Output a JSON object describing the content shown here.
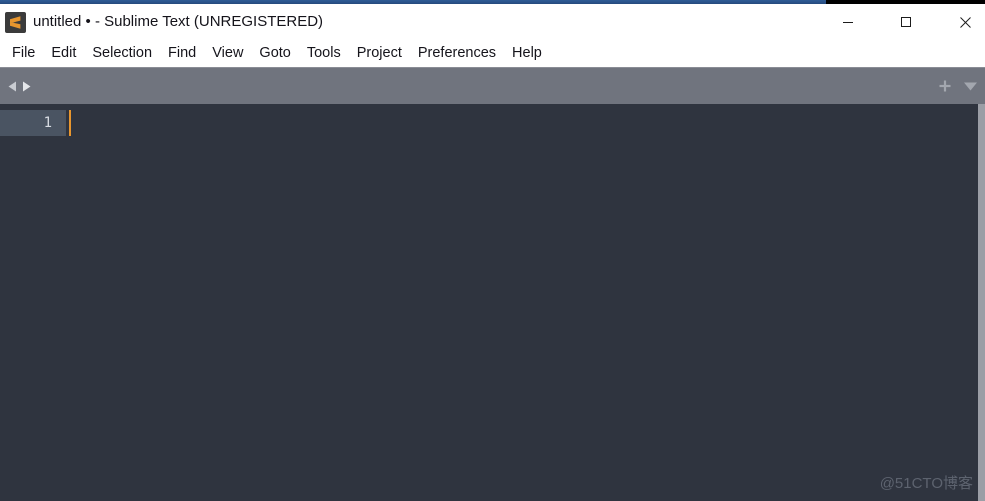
{
  "window": {
    "title": "untitled • - Sublime Text (UNREGISTERED)",
    "logo_icon": "sublime-text-logo",
    "accent_color": "#2a5289",
    "controls": {
      "minimize_label": "Minimize",
      "minimize_icon": "minimize-icon",
      "maximize_label": "Maximize",
      "maximize_icon": "maximize-icon",
      "close_label": "Close",
      "close_icon": "close-icon"
    }
  },
  "menubar": {
    "items": [
      {
        "label": "File"
      },
      {
        "label": "Edit"
      },
      {
        "label": "Selection"
      },
      {
        "label": "Find"
      },
      {
        "label": "View"
      },
      {
        "label": "Goto"
      },
      {
        "label": "Tools"
      },
      {
        "label": "Project"
      },
      {
        "label": "Preferences"
      },
      {
        "label": "Help"
      }
    ]
  },
  "tabbar": {
    "background_color": "#70747e",
    "scroll_left_icon": "triangle-left-icon",
    "scroll_right_icon": "triangle-right-icon",
    "new_tab_icon": "plus-icon",
    "tab_menu_icon": "chevron-down-icon",
    "tabs": []
  },
  "editor": {
    "background_color": "#2f343f",
    "line_numbers": [
      "1"
    ],
    "content": "",
    "caret_color": "#e8962e",
    "active_line_color": "#4a5462"
  },
  "watermark": {
    "text": "@51CTO博客"
  }
}
